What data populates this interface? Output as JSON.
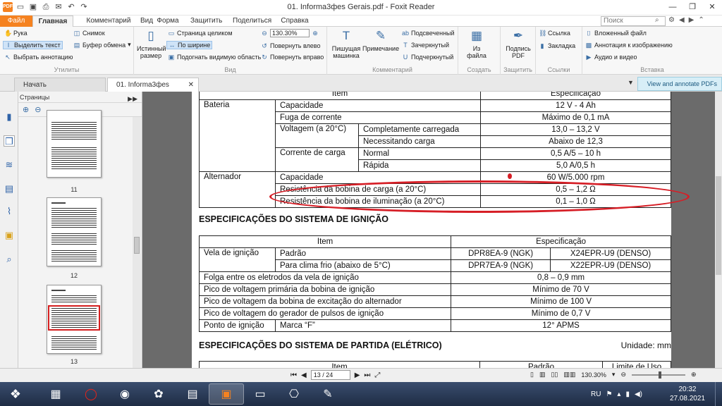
{
  "window": {
    "title": "01. Informa3фes Gerais.pdf - Foxit Reader",
    "app_icon": "PDF",
    "controls": [
      "—",
      "❐",
      "✕"
    ],
    "quick_access_icons": [
      "open-icon",
      "save-icon",
      "print-icon",
      "email-icon",
      "undo-icon",
      "redo-icon"
    ]
  },
  "ribbon_tabs": [
    {
      "label": "Файл"
    },
    {
      "label": "Главная"
    },
    {
      "label": "Комментарий"
    },
    {
      "label": "Вид"
    },
    {
      "label": "Форма"
    },
    {
      "label": "Защитить"
    },
    {
      "label": "Поделиться"
    },
    {
      "label": "Справка"
    }
  ],
  "search": {
    "placeholder": "Поиск"
  },
  "ribbon": {
    "groups": {
      "tools": "Утилиты",
      "view": "Вид",
      "comment": "Комментарий",
      "create": "Создать",
      "protect": "Защитить",
      "links": "Ссылки",
      "insert": "Вставка"
    },
    "hand": "Рука",
    "select_text": "Выделить текст",
    "select_annotation": "Выбрать аннотацию",
    "snapshot": "Снимок",
    "clipboard": "Буфер обмена",
    "actual_size": "Истинный размер",
    "fit_page": "Страница целиком",
    "fit_width": "По ширине",
    "fit_visible": "Подогнать видимую область",
    "zoom_value": "130.30%",
    "rotate_left": "Повернуть влево",
    "rotate_right": "Повернуть вправо",
    "typewriter": "Пишущая машинка",
    "note": "Примечание",
    "highlight": "Подсвеченный",
    "strikeout": "Зачеркнутый",
    "underline": "Подчеркнутый",
    "from_file": "Из файла",
    "sign": "Подпись PDF",
    "link": "Ссылка",
    "bookmark": "Закладка",
    "embedded_file": "Вложенный файл",
    "image_annotation": "Аннотация к изображению",
    "audio_video": "Аудио и видео"
  },
  "doc_tabs": {
    "start": "Начать",
    "document": "01. Informa3фes Gerais.pdf",
    "annotate_button": "View and annotate PDFs"
  },
  "sidebar": {
    "title": "Страницы",
    "thumbnails": [
      {
        "page": "11"
      },
      {
        "page": "12"
      },
      {
        "page": "13"
      }
    ]
  },
  "document": {
    "table1": {
      "header": [
        "Item",
        "Especificação"
      ],
      "rows": {
        "bateria": "Bateria",
        "capacidade": "Capacidade",
        "capacidade_val": "12 V - 4 Ah",
        "fuga": "Fuga de corrente",
        "fuga_val": "Máximo de 0,1 mA",
        "voltagem": "Voltagem (a 20°C)",
        "carregada": "Completamente carregada",
        "carregada_val": "13,0 – 13,2 V",
        "necessitando": "Necessitando carga",
        "necessitando_val": "Abaixo de 12,3",
        "corrente": "Corrente de carga",
        "normal": "Normal",
        "normal_val": "0,5 A/5 – 10 h",
        "rapida": "Rápida",
        "rapida_val": "5,0 A/0,5 h",
        "alternador": "Alternador",
        "alt_capacidade": "Capacidade",
        "alt_capacidade_val": "60 W/5.000 rpm",
        "bobina_carga": "Resistência da bobina de carga (a 20°C)",
        "bobina_carga_val": "0,5 – 1,2 Ω",
        "bobina_ilum": "Resistência da bobina de iluminação (a 20°C)",
        "bobina_ilum_val": "0,1 – 1,0 Ω"
      }
    },
    "section_ignicao": "ESPECIFICAÇÕES DO SISTEMA DE IGNIÇÃO",
    "table2": {
      "header": [
        "Item",
        "Especificação"
      ],
      "vela": "Vela de ignição",
      "padrao": "Padrão",
      "padrao_ngk": "DPR8EA-9 (NGK)",
      "padrao_denso": "X24EPR-U9 (DENSO)",
      "frio": "Para clima frio (abaixo de 5°C)",
      "frio_ngk": "DPR7EA-9 (NGK)",
      "frio_denso": "X22EPR-U9 (DENSO)",
      "folga": "Folga entre os eletrodos da vela de ignição",
      "folga_val": "0,8 – 0,9 mm",
      "pico1": "Pico de voltagem primária da bobina de ignição",
      "pico1_val": "Mínimo de 70 V",
      "pico2": "Pico de voltagem da bobina de excitação do alternador",
      "pico2_val": "Mínimo de 100 V",
      "pico3": "Pico de voltagem do gerador de pulsos de ignição",
      "pico3_val": "Mínimo de 0,7 V",
      "ponto": "Ponto de ignição",
      "marca": "Marca “F”",
      "ponto_val": "12° APMS"
    },
    "section_partida": "ESPECIFICAÇÕES DO SISTEMA DE PARTIDA (ELÉTRICO)",
    "unit": "Unidade: mm",
    "table3": {
      "header": [
        "Item",
        "Padrão",
        "Limite de Uso"
      ]
    }
  },
  "statusbar": {
    "page_indicator": "13 / 24",
    "zoom": "130.30%"
  },
  "taskbar": {
    "language": "RU",
    "time": "20:32",
    "date": "27.08.2021",
    "apps": [
      "calculator-icon",
      "opera-icon",
      "chrome-icon",
      "game-icon",
      "winrar-icon",
      "foxit-icon",
      "screenshot-icon",
      "network-icon",
      "paint-icon"
    ]
  },
  "colors": {
    "accent": "#f58220",
    "annotation_red": "#d61e26",
    "selection_blue": "#cfe3f7"
  }
}
